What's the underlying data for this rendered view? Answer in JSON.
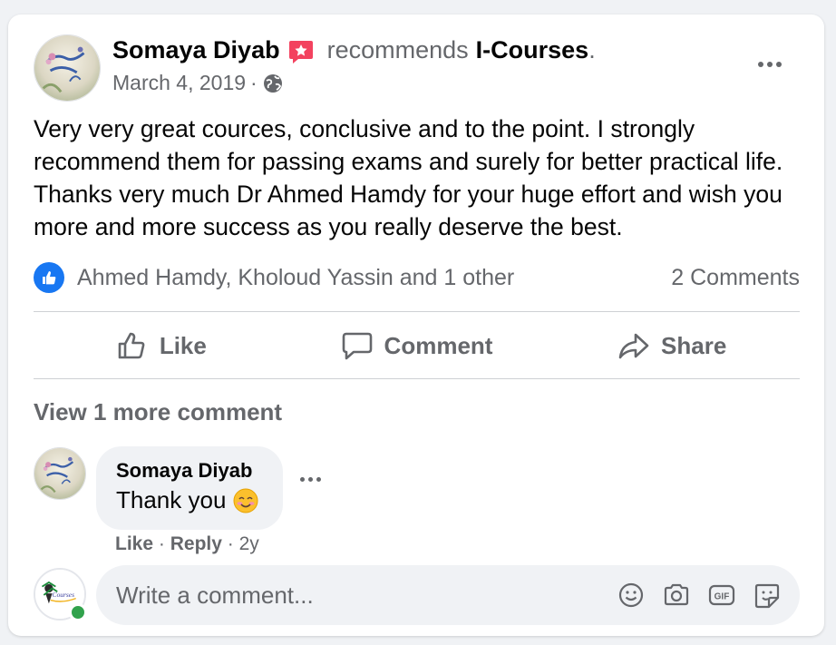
{
  "post": {
    "author": "Somaya Diyab",
    "recommends_text": "recommends",
    "page_name": "I-Courses",
    "page_suffix": ".",
    "date": "March 4, 2019",
    "date_sep": "·",
    "text": "Very very great cources, conclusive and to the point. I strongly recommend them for passing exams and surely for better practical life. Thanks very much Dr Ahmed Hamdy for your huge effort and wish you more and more success as you really deserve the best."
  },
  "reactions": {
    "reactors": "Ahmed Hamdy, Kholoud Yassin and 1 other",
    "comments_count": "2 Comments"
  },
  "actions": {
    "like": "Like",
    "comment": "Comment",
    "share": "Share"
  },
  "comments": {
    "view_more": "View 1 more comment",
    "items": [
      {
        "author": "Somaya Diyab",
        "text": "Thank you",
        "like": "Like",
        "sep1": "·",
        "reply": "Reply",
        "sep2": "·",
        "time": "2y"
      }
    ]
  },
  "composer": {
    "placeholder": "Write a comment..."
  },
  "icons": {
    "badge": "recommend-badge-icon",
    "globe": "globe-icon",
    "like_reaction": "like-reaction-icon",
    "emoji": "smiling-face-emoji",
    "write_icons": [
      "emoji-icon",
      "camera-icon",
      "gif-icon",
      "sticker-icon"
    ]
  },
  "colors": {
    "accent": "#1877f2",
    "badge": "#f3425f",
    "online": "#31a24c",
    "muted_text": "#65676b"
  }
}
